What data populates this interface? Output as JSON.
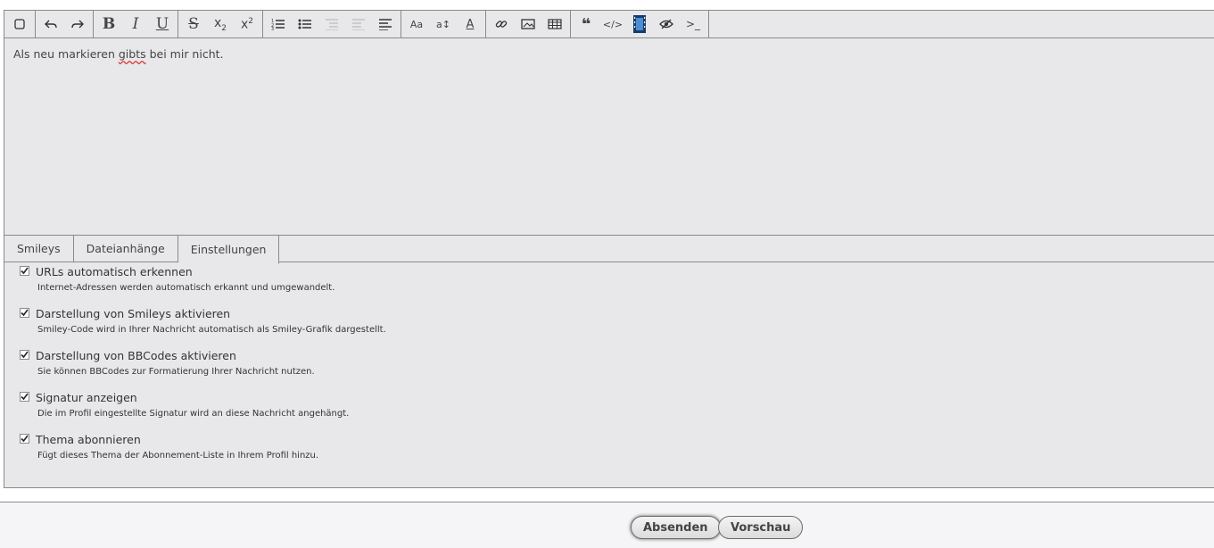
{
  "toolbar": {
    "groups": [
      [
        "source-toggle"
      ],
      [
        "undo",
        "redo"
      ],
      [
        "bold",
        "italic",
        "underline"
      ],
      [
        "strikethrough",
        "subscript",
        "superscript"
      ],
      [
        "ordered-list",
        "unordered-list",
        "indent",
        "outdent",
        "align"
      ],
      [
        "font-size",
        "font-family",
        "font-color"
      ],
      [
        "link",
        "image",
        "table"
      ],
      [
        "quote",
        "code",
        "media",
        "spoiler",
        "terminal"
      ]
    ],
    "bold_glyph": "B",
    "italic_glyph": "I",
    "underline_glyph": "U",
    "strike_glyph": "S",
    "font_size_glyph": "Aa",
    "font_family_glyph": "a↕",
    "font_color_glyph": "A",
    "code_glyph": "</>",
    "terminal_glyph": ">_"
  },
  "editor": {
    "text_before": "Als neu markieren ",
    "misspelled": "gibts",
    "text_after": " bei mir nicht."
  },
  "tabs": [
    {
      "label": "Smileys",
      "active": false
    },
    {
      "label": "Dateianhänge",
      "active": false
    },
    {
      "label": "Einstellungen",
      "active": true
    }
  ],
  "options": [
    {
      "label": "URLs automatisch erkennen",
      "desc": "Internet-Adressen werden automatisch erkannt und umgewandelt.",
      "checked": true
    },
    {
      "label": "Darstellung von Smileys aktivieren",
      "desc": "Smiley-Code wird in Ihrer Nachricht automatisch als Smiley-Grafik dargestellt.",
      "checked": true
    },
    {
      "label": "Darstellung von BBCodes aktivieren",
      "desc": "Sie können BBCodes zur Formatierung Ihrer Nachricht nutzen.",
      "checked": true
    },
    {
      "label": "Signatur anzeigen",
      "desc": "Die im Profil eingestellte Signatur wird an diese Nachricht angehängt.",
      "checked": true
    },
    {
      "label": "Thema abonnieren",
      "desc": "Fügt dieses Thema der Abonnement-Liste in Ihrem Profil hinzu.",
      "checked": true
    }
  ],
  "buttons": {
    "submit": "Absenden",
    "preview": "Vorschau"
  }
}
